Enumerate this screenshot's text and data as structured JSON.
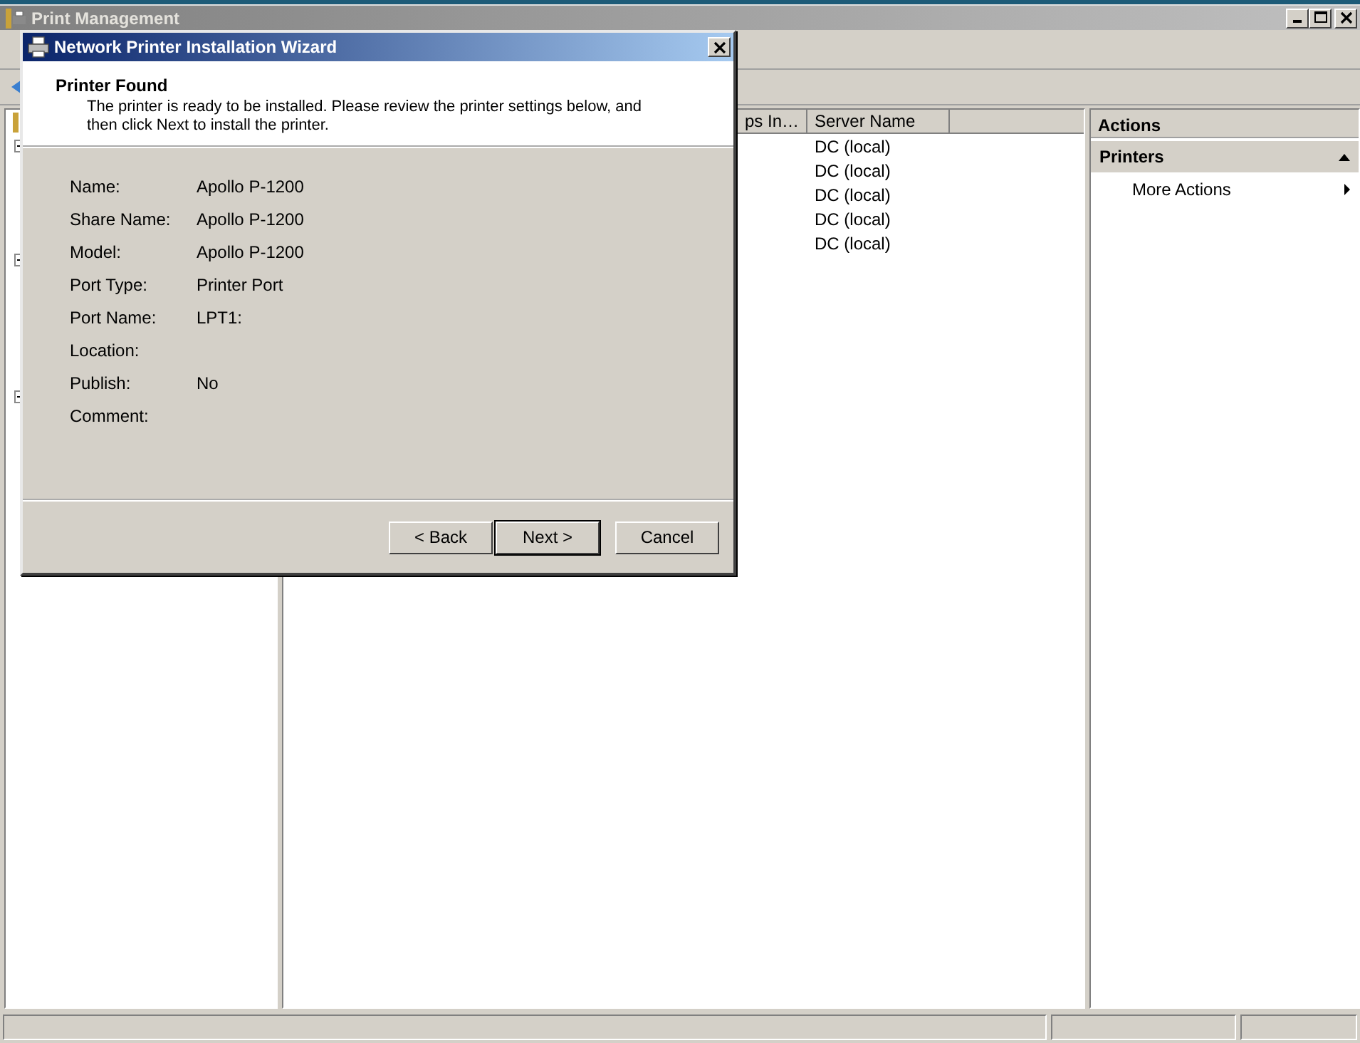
{
  "main_window": {
    "title": "Print Management",
    "window_buttons": [
      {
        "kind": "minimize"
      },
      {
        "kind": "maximize"
      },
      {
        "kind": "close"
      }
    ]
  },
  "list": {
    "columns": [
      "ps In…",
      "Server Name"
    ],
    "rows": [
      {
        "server_name": "DC (local)"
      },
      {
        "server_name": "DC (local)"
      },
      {
        "server_name": "DC (local)"
      },
      {
        "server_name": "DC (local)"
      },
      {
        "server_name": "DC (local)"
      }
    ]
  },
  "actions": {
    "title": "Actions",
    "section": {
      "title": "Printers",
      "expanded": true
    },
    "items": [
      "More Actions"
    ]
  },
  "dialog": {
    "title": "Network Printer Installation Wizard",
    "heading": "Printer Found",
    "description": "The printer is ready to be installed. Please review the printer settings below, and then click Next to install the printer.",
    "fields": [
      {
        "label": "Name:",
        "value": "Apollo P-1200"
      },
      {
        "label": "Share Name:",
        "value": "Apollo P-1200"
      },
      {
        "label": "Model:",
        "value": "Apollo P-1200"
      },
      {
        "label": "Port Type:",
        "value": "Printer Port"
      },
      {
        "label": "Port Name:",
        "value": "LPT1:"
      },
      {
        "label": "Location:"
      },
      {
        "label": "Publish:",
        "value": "No"
      },
      {
        "label": "Comment:"
      }
    ],
    "buttons": [
      {
        "label": "< Back",
        "default": false
      },
      {
        "label": "Next >",
        "default": true
      },
      {
        "label": "Cancel",
        "default": false
      }
    ]
  }
}
